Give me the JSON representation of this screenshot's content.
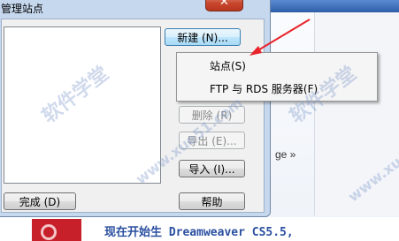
{
  "dialog": {
    "title": "管理站点",
    "close_label": "✕"
  },
  "buttons": {
    "new": "新建 (N)...",
    "delete": "删除 (R)",
    "export": "导出 (E)...",
    "import": "导入 (I)...",
    "done": "完成 (D)",
    "help": "帮助"
  },
  "menu": {
    "items": [
      "站点(S)",
      "FTP 与 RDS 服务器(F)"
    ]
  },
  "background": {
    "link_text": "ge »",
    "bottom_text": "现在开始生 Dreamweaver CS5.5,"
  },
  "watermark": {
    "cn": "软件学堂",
    "url": "www.xue51.com"
  },
  "colors": {
    "arrow": "#e8232a",
    "dialog_frame": "#c6d8ee",
    "close_button": "#c8472e"
  }
}
